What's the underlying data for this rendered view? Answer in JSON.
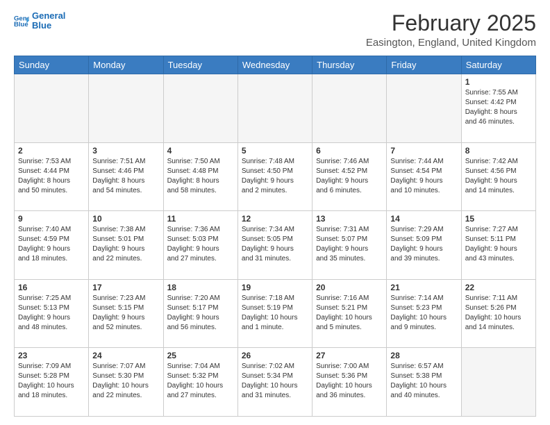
{
  "header": {
    "logo_line1": "General",
    "logo_line2": "Blue",
    "title": "February 2025",
    "subtitle": "Easington, England, United Kingdom"
  },
  "days_of_week": [
    "Sunday",
    "Monday",
    "Tuesday",
    "Wednesday",
    "Thursday",
    "Friday",
    "Saturday"
  ],
  "weeks": [
    [
      {
        "day": "",
        "info": "",
        "empty": true
      },
      {
        "day": "",
        "info": "",
        "empty": true
      },
      {
        "day": "",
        "info": "",
        "empty": true
      },
      {
        "day": "",
        "info": "",
        "empty": true
      },
      {
        "day": "",
        "info": "",
        "empty": true
      },
      {
        "day": "",
        "info": "",
        "empty": true
      },
      {
        "day": "1",
        "info": "Sunrise: 7:55 AM\nSunset: 4:42 PM\nDaylight: 8 hours\nand 46 minutes.",
        "empty": false
      }
    ],
    [
      {
        "day": "2",
        "info": "Sunrise: 7:53 AM\nSunset: 4:44 PM\nDaylight: 8 hours\nand 50 minutes.",
        "empty": false
      },
      {
        "day": "3",
        "info": "Sunrise: 7:51 AM\nSunset: 4:46 PM\nDaylight: 8 hours\nand 54 minutes.",
        "empty": false
      },
      {
        "day": "4",
        "info": "Sunrise: 7:50 AM\nSunset: 4:48 PM\nDaylight: 8 hours\nand 58 minutes.",
        "empty": false
      },
      {
        "day": "5",
        "info": "Sunrise: 7:48 AM\nSunset: 4:50 PM\nDaylight: 9 hours\nand 2 minutes.",
        "empty": false
      },
      {
        "day": "6",
        "info": "Sunrise: 7:46 AM\nSunset: 4:52 PM\nDaylight: 9 hours\nand 6 minutes.",
        "empty": false
      },
      {
        "day": "7",
        "info": "Sunrise: 7:44 AM\nSunset: 4:54 PM\nDaylight: 9 hours\nand 10 minutes.",
        "empty": false
      },
      {
        "day": "8",
        "info": "Sunrise: 7:42 AM\nSunset: 4:56 PM\nDaylight: 9 hours\nand 14 minutes.",
        "empty": false
      }
    ],
    [
      {
        "day": "9",
        "info": "Sunrise: 7:40 AM\nSunset: 4:59 PM\nDaylight: 9 hours\nand 18 minutes.",
        "empty": false
      },
      {
        "day": "10",
        "info": "Sunrise: 7:38 AM\nSunset: 5:01 PM\nDaylight: 9 hours\nand 22 minutes.",
        "empty": false
      },
      {
        "day": "11",
        "info": "Sunrise: 7:36 AM\nSunset: 5:03 PM\nDaylight: 9 hours\nand 27 minutes.",
        "empty": false
      },
      {
        "day": "12",
        "info": "Sunrise: 7:34 AM\nSunset: 5:05 PM\nDaylight: 9 hours\nand 31 minutes.",
        "empty": false
      },
      {
        "day": "13",
        "info": "Sunrise: 7:31 AM\nSunset: 5:07 PM\nDaylight: 9 hours\nand 35 minutes.",
        "empty": false
      },
      {
        "day": "14",
        "info": "Sunrise: 7:29 AM\nSunset: 5:09 PM\nDaylight: 9 hours\nand 39 minutes.",
        "empty": false
      },
      {
        "day": "15",
        "info": "Sunrise: 7:27 AM\nSunset: 5:11 PM\nDaylight: 9 hours\nand 43 minutes.",
        "empty": false
      }
    ],
    [
      {
        "day": "16",
        "info": "Sunrise: 7:25 AM\nSunset: 5:13 PM\nDaylight: 9 hours\nand 48 minutes.",
        "empty": false
      },
      {
        "day": "17",
        "info": "Sunrise: 7:23 AM\nSunset: 5:15 PM\nDaylight: 9 hours\nand 52 minutes.",
        "empty": false
      },
      {
        "day": "18",
        "info": "Sunrise: 7:20 AM\nSunset: 5:17 PM\nDaylight: 9 hours\nand 56 minutes.",
        "empty": false
      },
      {
        "day": "19",
        "info": "Sunrise: 7:18 AM\nSunset: 5:19 PM\nDaylight: 10 hours\nand 1 minute.",
        "empty": false
      },
      {
        "day": "20",
        "info": "Sunrise: 7:16 AM\nSunset: 5:21 PM\nDaylight: 10 hours\nand 5 minutes.",
        "empty": false
      },
      {
        "day": "21",
        "info": "Sunrise: 7:14 AM\nSunset: 5:23 PM\nDaylight: 10 hours\nand 9 minutes.",
        "empty": false
      },
      {
        "day": "22",
        "info": "Sunrise: 7:11 AM\nSunset: 5:26 PM\nDaylight: 10 hours\nand 14 minutes.",
        "empty": false
      }
    ],
    [
      {
        "day": "23",
        "info": "Sunrise: 7:09 AM\nSunset: 5:28 PM\nDaylight: 10 hours\nand 18 minutes.",
        "empty": false
      },
      {
        "day": "24",
        "info": "Sunrise: 7:07 AM\nSunset: 5:30 PM\nDaylight: 10 hours\nand 22 minutes.",
        "empty": false
      },
      {
        "day": "25",
        "info": "Sunrise: 7:04 AM\nSunset: 5:32 PM\nDaylight: 10 hours\nand 27 minutes.",
        "empty": false
      },
      {
        "day": "26",
        "info": "Sunrise: 7:02 AM\nSunset: 5:34 PM\nDaylight: 10 hours\nand 31 minutes.",
        "empty": false
      },
      {
        "day": "27",
        "info": "Sunrise: 7:00 AM\nSunset: 5:36 PM\nDaylight: 10 hours\nand 36 minutes.",
        "empty": false
      },
      {
        "day": "28",
        "info": "Sunrise: 6:57 AM\nSunset: 5:38 PM\nDaylight: 10 hours\nand 40 minutes.",
        "empty": false
      },
      {
        "day": "",
        "info": "",
        "empty": true
      }
    ]
  ]
}
